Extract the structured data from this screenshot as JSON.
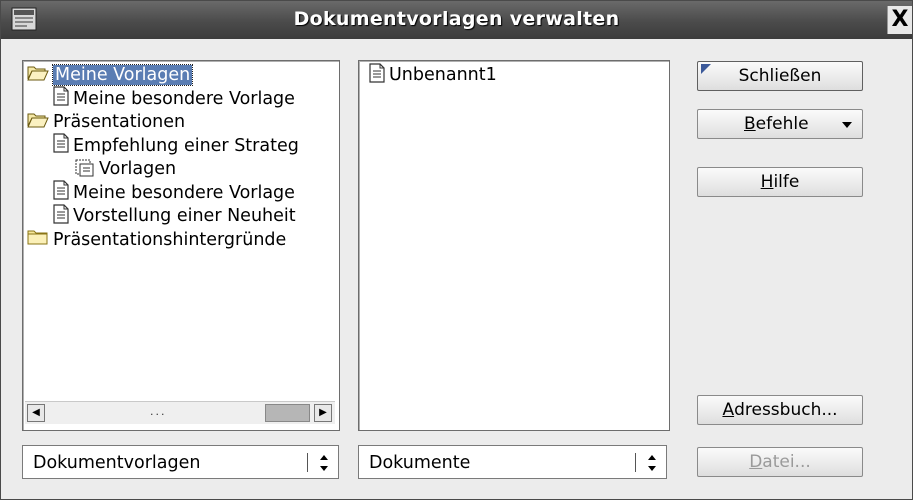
{
  "window": {
    "title": "Dokumentvorlagen verwalten",
    "close_label": "X"
  },
  "left_tree": {
    "items": [
      {
        "label": "Meine Vorlagen",
        "icon": "folder-open-icon",
        "level": 0,
        "selected": true
      },
      {
        "label": "Meine besondere Vorlage",
        "icon": "document-icon",
        "level": 1
      },
      {
        "label": "Präsentationen",
        "icon": "folder-open-icon",
        "level": 0
      },
      {
        "label": "Empfehlung einer Strateg",
        "icon": "document-icon",
        "level": 1
      },
      {
        "label": "Vorlagen",
        "icon": "styles-icon",
        "level": 2
      },
      {
        "label": "Meine besondere Vorlage",
        "icon": "document-icon",
        "level": 1
      },
      {
        "label": "Vorstellung einer Neuheit",
        "icon": "document-icon",
        "level": 1
      },
      {
        "label": "Präsentationshintergründe",
        "icon": "folder-closed-icon",
        "level": 0
      }
    ],
    "scrollbar_dots": "..."
  },
  "right_list": {
    "items": [
      {
        "label": "Unbenannt1",
        "icon": "document-icon"
      }
    ]
  },
  "buttons": {
    "close": "Schließen",
    "commands_u": "B",
    "commands_rest": "efehle",
    "help_u": "H",
    "help_rest": "ilfe",
    "addressbook_u": "A",
    "addressbook_rest": "dressbuch...",
    "file_u": "D",
    "file_rest": "atei..."
  },
  "selects": {
    "left": "Dokumentvorlagen",
    "right": "Dokumente"
  },
  "colors": {
    "selection": "#5a7db3",
    "titlebar": "#4b4b4b",
    "disabled_text": "#9a9a9a"
  }
}
